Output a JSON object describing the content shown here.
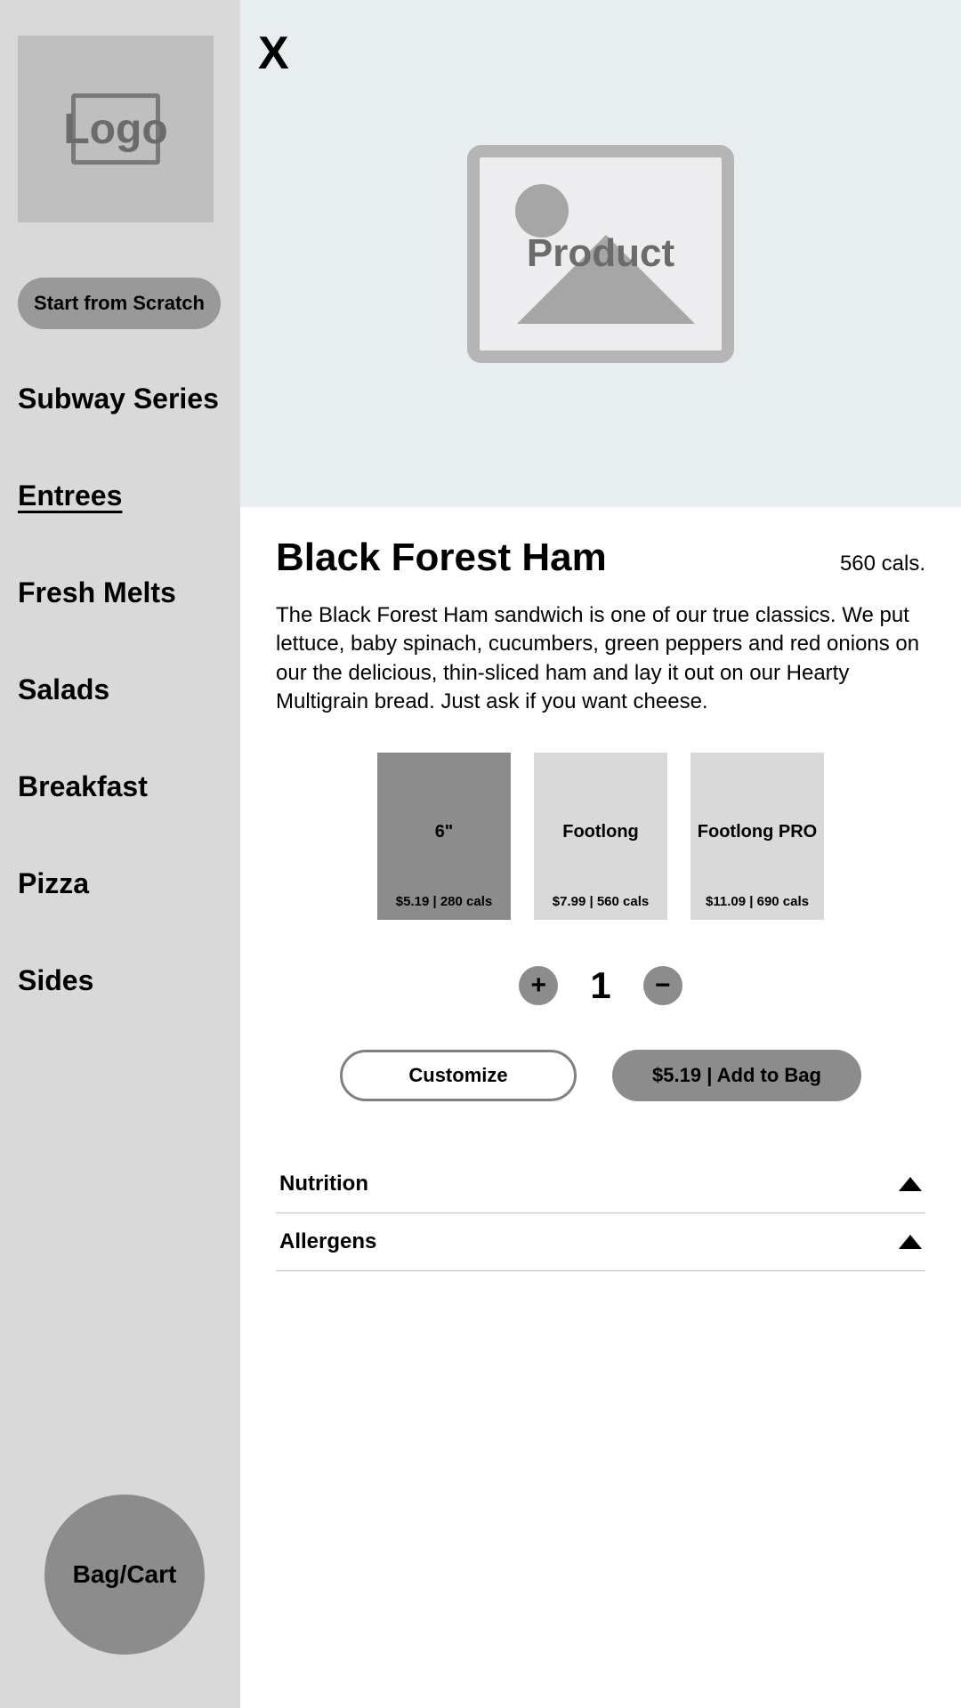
{
  "sidebar": {
    "logo_label": "Logo",
    "cta_label": "Start from Scratch",
    "categories": [
      {
        "label": "Subway Series",
        "active": false
      },
      {
        "label": "Entrees",
        "active": true
      },
      {
        "label": "Fresh Melts",
        "active": false
      },
      {
        "label": "Salads",
        "active": false
      },
      {
        "label": "Breakfast",
        "active": false
      },
      {
        "label": "Pizza",
        "active": false
      },
      {
        "label": "Sides",
        "active": false
      }
    ],
    "cart_label": "Bag/Cart"
  },
  "product": {
    "close_icon_label": "X",
    "image_placeholder": "Product",
    "title": "Black Forest Ham",
    "header_cals": "560 cals.",
    "description": "The Black Forest Ham sandwich is one of our true classics. We put lettuce, baby spinach, cucumbers, green peppers and red onions on our the delicious, thin-sliced ham and lay it out on our Hearty Multigrain bread. Just ask if you want cheese.",
    "sizes": [
      {
        "name": "6\"",
        "price": "$5.19",
        "cals": "280 cals",
        "selected": true
      },
      {
        "name": "Footlong",
        "price": "$7.99",
        "cals": "560 cals",
        "selected": false
      },
      {
        "name": "Footlong PRO",
        "price": "$11.09",
        "cals": "690 cals",
        "selected": false
      }
    ],
    "quantity": "1",
    "customize_label": "Customize",
    "add_to_bag_label": "$5.19 | Add to Bag",
    "accordion": [
      {
        "label": "Nutrition"
      },
      {
        "label": "Allergens"
      }
    ]
  }
}
